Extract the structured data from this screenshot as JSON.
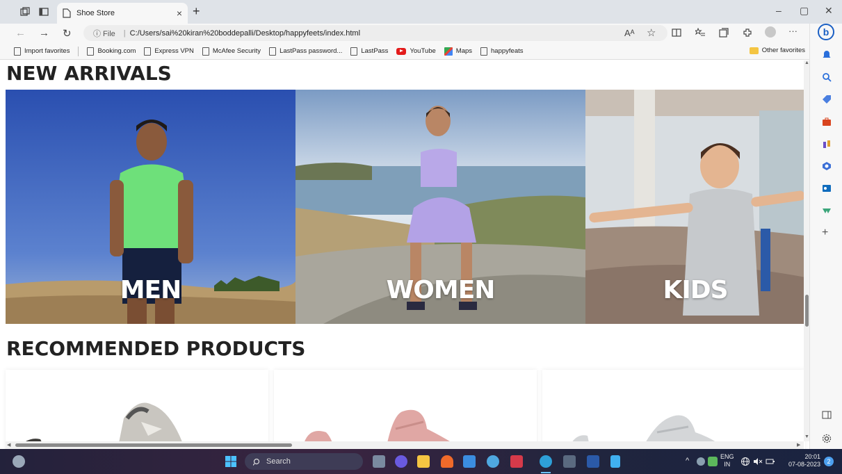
{
  "browser": {
    "tab_title": "Shoe Store",
    "tab_close": "×",
    "new_tab": "+",
    "window_controls": [
      "–",
      "▢",
      "✕"
    ],
    "file_label": "ⓘ File",
    "url_separator": "|",
    "url": "C:/Users/sai%20kiran%20boddepalli/Desktop/happyfeets/index.html",
    "read_aloud": "Aᴬ",
    "favorite_star": "☆",
    "more": "···",
    "bookmarks": [
      {
        "label": "Import favorites",
        "icon": "import-icon"
      },
      {
        "label": "Booking.com",
        "icon": "page-icon"
      },
      {
        "label": "Express VPN",
        "icon": "page-icon"
      },
      {
        "label": "McAfee Security",
        "icon": "page-icon"
      },
      {
        "label": "LastPass password...",
        "icon": "page-icon"
      },
      {
        "label": "LastPass",
        "icon": "page-icon"
      },
      {
        "label": "YouTube",
        "icon": "youtube-icon"
      },
      {
        "label": "Maps",
        "icon": "maps-icon"
      },
      {
        "label": "happyfeats",
        "icon": "page-icon"
      }
    ],
    "other_favorites": "Other favorites"
  },
  "page": {
    "new_arrivals_title": "NEW ARRIVALS",
    "categories": [
      {
        "label": "MEN",
        "colors": [
          "#2f57b8",
          "#5f84cf",
          "#b89b6c"
        ]
      },
      {
        "label": "WOMEN",
        "colors": [
          "#9fb8d4",
          "#e8eef3",
          "#8d8a7c"
        ]
      },
      {
        "label": "KIDS",
        "colors": [
          "#d9dfe4",
          "#c3b8ad",
          "#9e8777"
        ]
      }
    ],
    "recommended_title": "RECOMMENDED PRODUCTS",
    "products": [
      {
        "shoe_color": "#c9c6c0"
      },
      {
        "shoe_color": "#e0a7a4"
      },
      {
        "shoe_color": "#d4d6d8"
      }
    ]
  },
  "taskbar": {
    "search_placeholder": "Search",
    "lang_top": "ENG",
    "lang_bottom": "IN",
    "time": "20:01",
    "date": "07-08-2023",
    "notification_count": "2"
  }
}
